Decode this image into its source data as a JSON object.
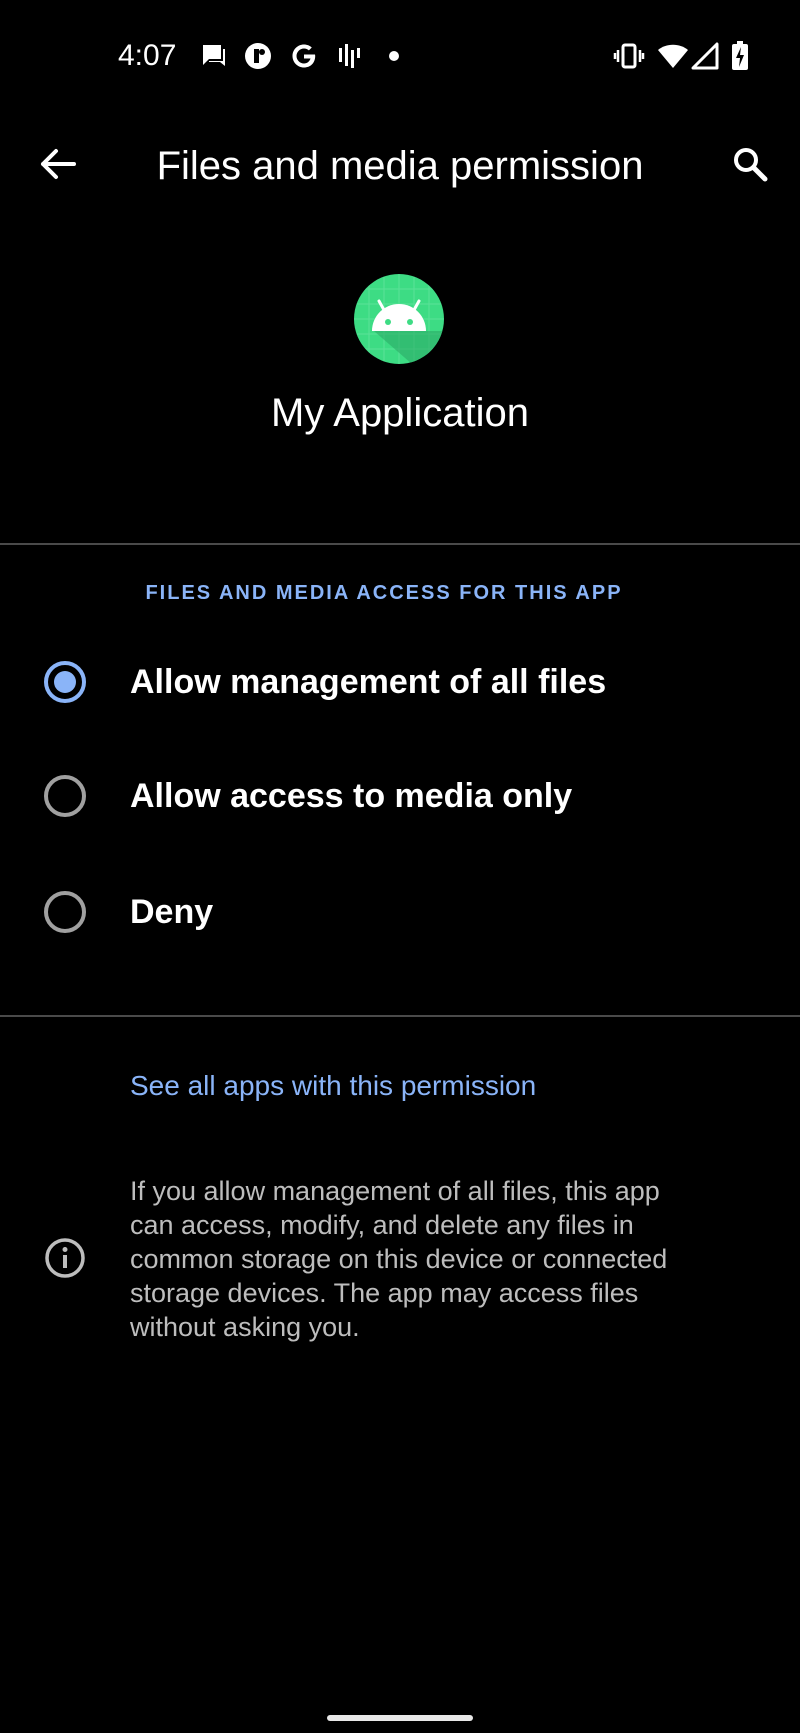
{
  "status_bar": {
    "time": "4:07",
    "left_icons": [
      "message-icon",
      "app-notification-icon",
      "google-icon",
      "voicemail-icon",
      "dot-icon"
    ],
    "right_icons": [
      "vibrate-icon",
      "wifi-icon",
      "signal-icon",
      "battery-charging-icon"
    ]
  },
  "app_bar": {
    "title": "Files and media permission",
    "back_icon": "arrow-left-icon",
    "search_icon": "search-icon"
  },
  "app_header": {
    "app_name": "My Application",
    "icon": "android-app-icon"
  },
  "permission": {
    "section_title": "FILES AND MEDIA ACCESS FOR THIS APP",
    "options": [
      {
        "label": "Allow management of all files",
        "selected": true
      },
      {
        "label": "Allow access to media only",
        "selected": false
      },
      {
        "label": "Deny",
        "selected": false
      }
    ]
  },
  "footer": {
    "link": "See all apps with this permission",
    "info_text": "If you allow management of all files, this app can access, modify, and delete any files in common storage on this device or connected storage devices. The app may access files without asking you."
  },
  "colors": {
    "background": "#000000",
    "accent": "#8ab4f8",
    "android_green": "#3ddc84"
  }
}
